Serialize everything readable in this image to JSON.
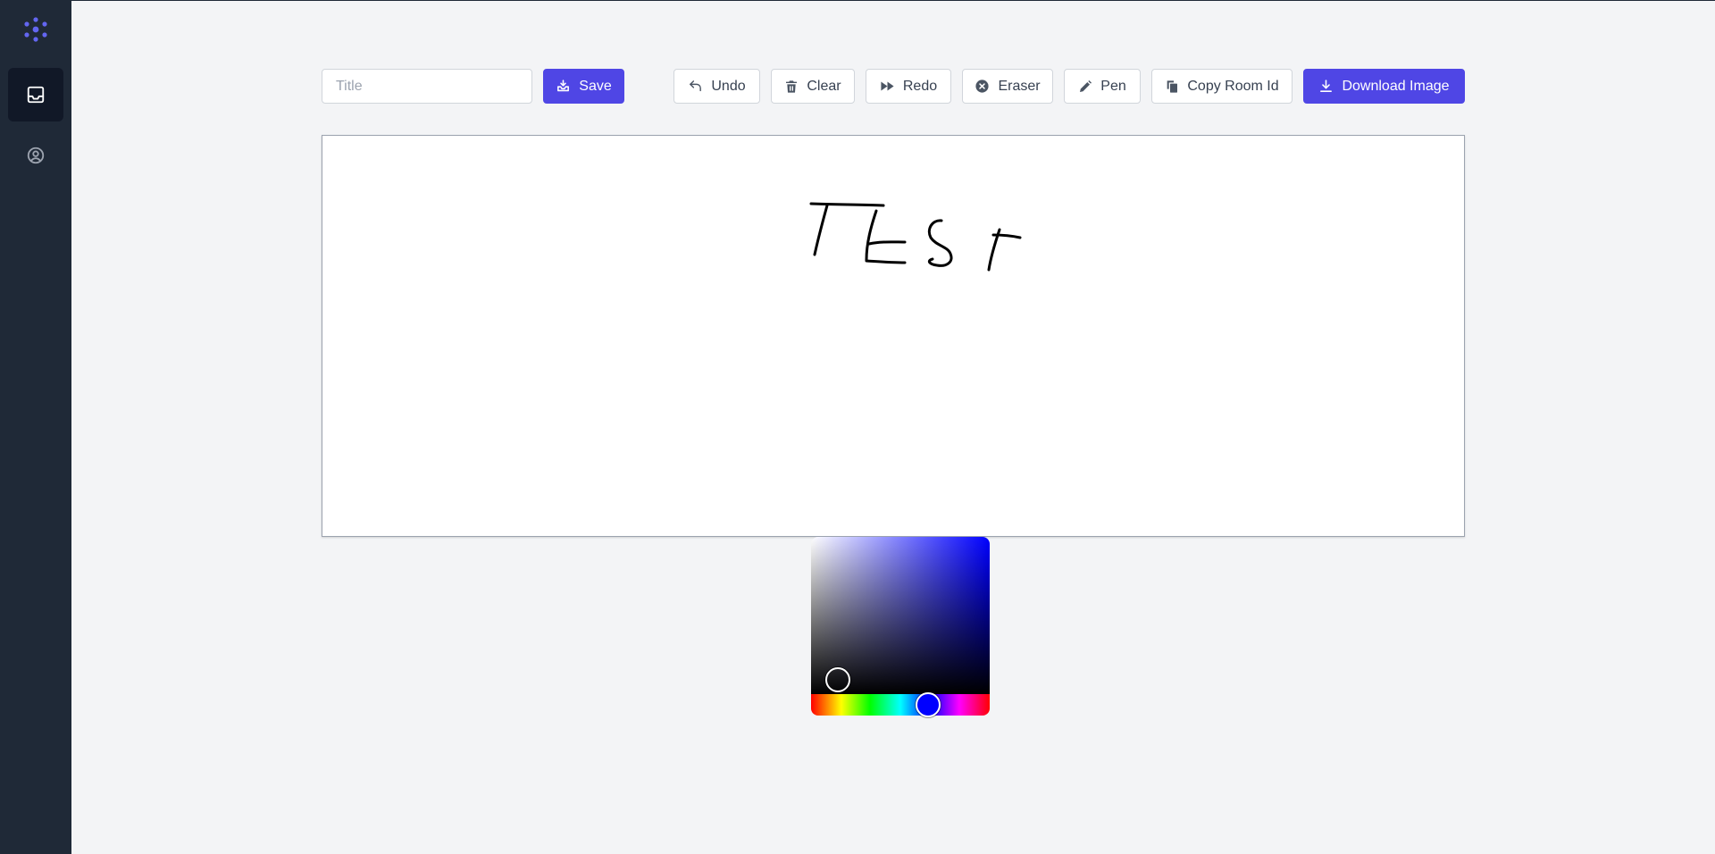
{
  "sidebar": {
    "logo_icon": "dots-logo-icon",
    "accent": "#6366f1",
    "items": [
      {
        "name": "inbox",
        "icon": "inbox-icon",
        "active": true
      },
      {
        "name": "profile",
        "icon": "user-circle-icon",
        "active": false
      }
    ]
  },
  "toolbar": {
    "title_placeholder": "Title",
    "title_value": "",
    "save_label": "Save",
    "undo_label": "Undo",
    "clear_label": "Clear",
    "redo_label": "Redo",
    "eraser_label": "Eraser",
    "pen_label": "Pen",
    "copy_room_label": "Copy Room Id",
    "download_label": "Download Image"
  },
  "canvas": {
    "drawing_text": "TEST",
    "stroke_color": "#000000"
  },
  "color_picker": {
    "hue_color": "#0000ff",
    "selected_color": "#000000",
    "hue_position": 0.66,
    "saturation": 0.15,
    "value": 0.1
  },
  "colors": {
    "primary": "#4f46e5",
    "sidebar_bg": "#1f2937",
    "page_bg": "#f3f4f6"
  }
}
